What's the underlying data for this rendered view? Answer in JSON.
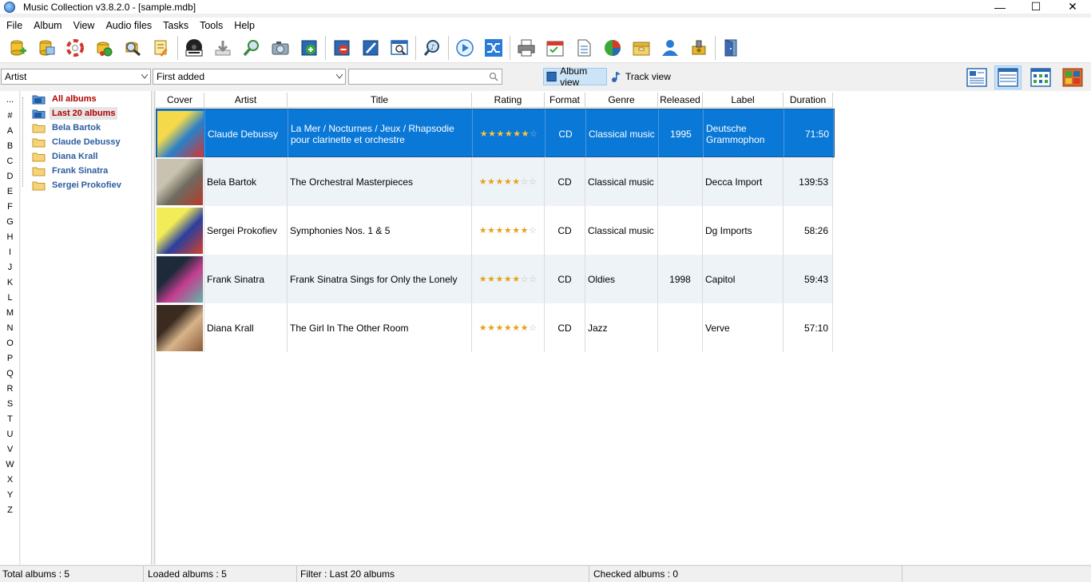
{
  "window": {
    "title": "Music Collection v3.8.2.0 - [sample.mdb]",
    "min_glyph": "—",
    "max_glyph": "☐",
    "close_glyph": "✕"
  },
  "menu": [
    "File",
    "Album",
    "View",
    "Audio files",
    "Tasks",
    "Tools",
    "Help"
  ],
  "toolbar_icons": [
    "new-database-icon",
    "open-database-icon",
    "help-lifebuoy-icon",
    "recycle-icon",
    "search-disk-icon",
    "edit-notes-icon",
    "text-cd-icon",
    "download-icon",
    "zoom-in-icon",
    "camera-icon",
    "add-album-icon",
    "delete-album-icon",
    "edit-album-icon",
    "preview-icon",
    "audio-search-icon",
    "play-icon",
    "shuffle-icon",
    "print-icon",
    "calendar-icon",
    "report-icon",
    "pie-chart-icon",
    "archive-icon",
    "user-icon",
    "plugin-icon",
    "exit-icon"
  ],
  "filter": {
    "group_by": "Artist",
    "sort_by": "First added",
    "search_value": "",
    "album_view_label": "Album view",
    "track_view_label": "Track view"
  },
  "alphabet": [
    "...",
    "#",
    "A",
    "B",
    "C",
    "D",
    "E",
    "F",
    "G",
    "H",
    "I",
    "J",
    "K",
    "L",
    "M",
    "N",
    "O",
    "P",
    "Q",
    "R",
    "S",
    "T",
    "U",
    "V",
    "W",
    "X",
    "Y",
    "Z"
  ],
  "tree": [
    {
      "label": "All albums",
      "style": "red",
      "icon": "folder-blue-icon"
    },
    {
      "label": "Last 20 albums",
      "style": "red",
      "icon": "folder-blue-icon",
      "selected": true
    },
    {
      "label": "Bela Bartok",
      "style": "blue",
      "icon": "folder-icon"
    },
    {
      "label": "Claude Debussy",
      "style": "blue",
      "icon": "folder-icon"
    },
    {
      "label": "Diana Krall",
      "style": "blue",
      "icon": "folder-icon"
    },
    {
      "label": "Frank Sinatra",
      "style": "blue",
      "icon": "folder-icon"
    },
    {
      "label": "Sergei Prokofiev",
      "style": "blue",
      "icon": "folder-icon"
    }
  ],
  "grid": {
    "columns": [
      "Cover",
      "Artist",
      "Title",
      "Rating",
      "Format",
      "Genre",
      "Released",
      "Label",
      "Duration"
    ],
    "rows": [
      {
        "artist": "Claude Debussy",
        "title": "La Mer / Nocturnes / Jeux / Rhapsodie pour clarinette et orchestre",
        "rating": 6,
        "rating_max": 7,
        "format": "CD",
        "genre": "Classical music",
        "released": "1995",
        "label": "Deutsche Grammophon",
        "duration": "71:50",
        "cover_colors": [
          "#f4d94a",
          "#2a7fc8",
          "#d8342c"
        ],
        "selected": true
      },
      {
        "artist": "Bela Bartok",
        "title": "The Orchestral Masterpieces",
        "rating": 5,
        "rating_max": 7,
        "format": "CD",
        "genre": "Classical music",
        "released": "",
        "label": "Decca Import",
        "duration": "139:53",
        "cover_colors": [
          "#c9c2b0",
          "#6e6a5e",
          "#b83a2c"
        ],
        "selected": false
      },
      {
        "artist": "Sergei Prokofiev",
        "title": "Symphonies Nos. 1 & 5",
        "rating": 6,
        "rating_max": 7,
        "format": "CD",
        "genre": "Classical music",
        "released": "",
        "label": "Dg Imports",
        "duration": "58:26",
        "cover_colors": [
          "#f2ec58",
          "#2a3f9e",
          "#d8402a"
        ],
        "selected": false
      },
      {
        "artist": "Frank Sinatra",
        "title": "Frank Sinatra Sings for Only the Lonely",
        "rating": 5,
        "rating_max": 7,
        "format": "CD",
        "genre": "Oldies",
        "released": "1998",
        "label": "Capitol",
        "duration": "59:43",
        "cover_colors": [
          "#1e2a3a",
          "#c43d8f",
          "#5fb7a8"
        ],
        "selected": false
      },
      {
        "artist": "Diana Krall",
        "title": "The Girl In The Other Room",
        "rating": 6,
        "rating_max": 7,
        "format": "CD",
        "genre": "Jazz",
        "released": "",
        "label": "Verve",
        "duration": "57:10",
        "cover_colors": [
          "#3a2a20",
          "#d8b48a",
          "#8a5a38"
        ],
        "selected": false
      }
    ]
  },
  "status": {
    "total": "Total albums : 5",
    "loaded": "Loaded albums : 5",
    "filter": "Filter : Last 20 albums",
    "checked": "Checked albums : 0"
  }
}
